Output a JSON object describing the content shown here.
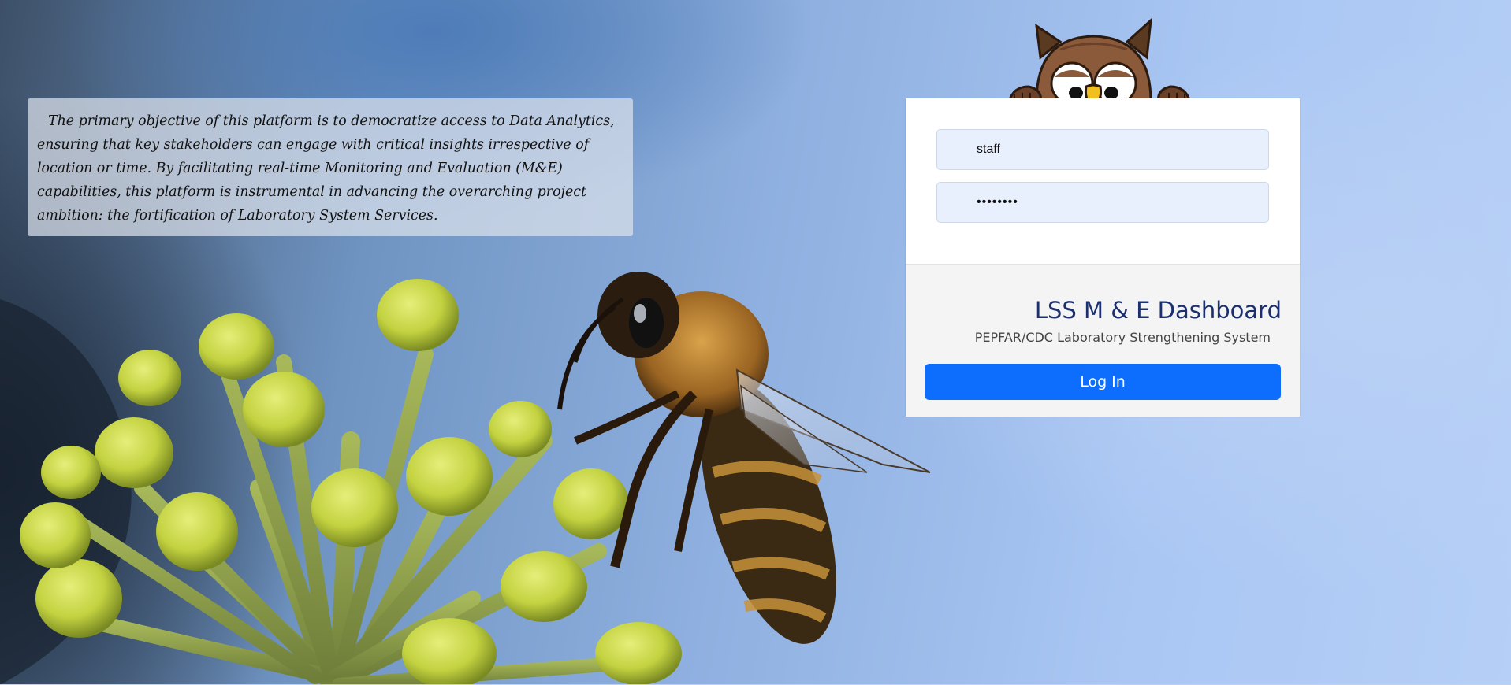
{
  "objective": {
    "text": "The primary objective of this platform is to democratize access to Data Analytics, ensuring that key stakeholders can engage with critical insights irrespective of location or time. By facilitating real-time Monitoring and Evaluation (M&E) capabilities, this platform is instrumental in advancing the overarching project ambition: the fortification of Laboratory System Services."
  },
  "login": {
    "username_value": "staff",
    "password_value": "••••••••",
    "title": "LSS M & E Dashboard",
    "subtitle": "PEPFAR/CDC Laboratory Strengthening System",
    "button_label": "Log In"
  },
  "icons": {
    "mascot": "owl-mascot-icon",
    "background": "bee-on-flower-photo"
  },
  "colors": {
    "primary_button": "#0d6efd",
    "title": "#1c2f6e",
    "field_background": "#e8f0fe"
  }
}
